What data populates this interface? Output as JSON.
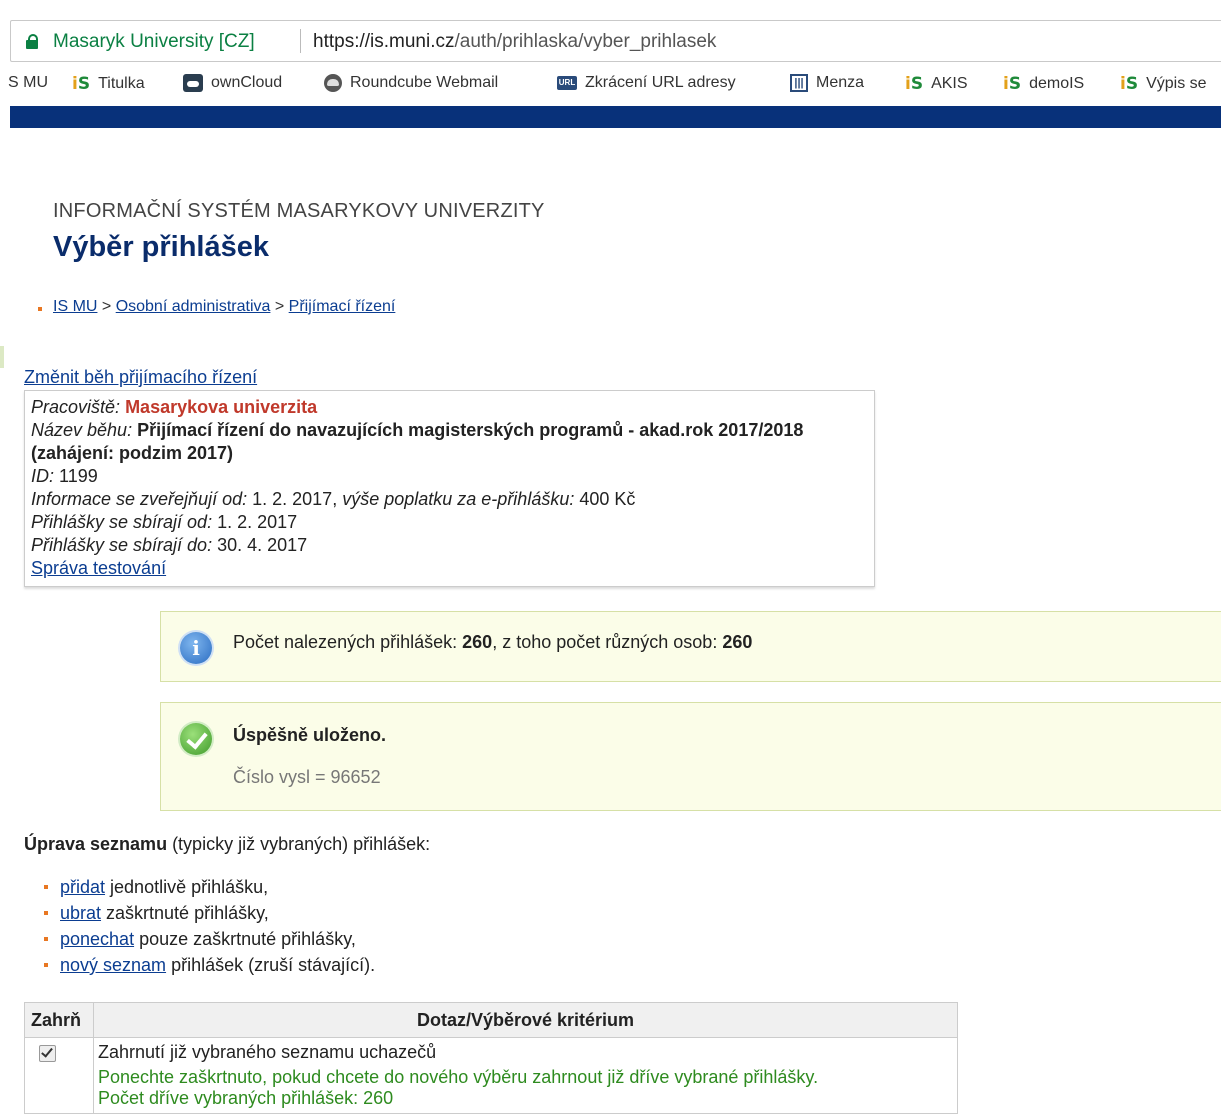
{
  "browser": {
    "origin": "Masaryk University [CZ]",
    "url_host": "https://is.muni.cz",
    "url_path": "/auth/prihlaska/vyber_prihlasek",
    "bookmarks": [
      "S MU",
      "Titulka",
      "ownCloud",
      "Roundcube Webmail",
      "Zkrácení URL adresy",
      "Menza",
      "AKIS",
      "demoIS",
      "Výpis se"
    ]
  },
  "page": {
    "system_name": "INFORMAČNÍ SYSTÉM MASARYKOVY UNIVERZITY",
    "title": "Výběr přihlášek",
    "breadcrumb": [
      "IS MU",
      "Osobní administrativa",
      "Přijímací řízení"
    ],
    "breadcrumb_sep": " > "
  },
  "change_link": "Změnit běh přijímacího řízení",
  "info": {
    "workplace_label": "Pracoviště:",
    "workplace": "Masarykova univerzita",
    "run_label": "Název běhu:",
    "run_name": "Přijímací řízení do navazujících magisterských programů - akad.rok 2017/2018 (zahájení: podzim 2017)",
    "id_label": "ID:",
    "id": "1199",
    "publish_label": "Informace se zveřejňují od:",
    "publish_from": "1. 2. 2017,",
    "fee_label": "výše poplatku za e-přihlášku:",
    "fee": "400 Kč",
    "collect_from_label": "Přihlášky se sbírají od:",
    "collect_from": "1. 2. 2017",
    "collect_to_label": "Přihlášky se sbírají do:",
    "collect_to": "30. 4. 2017",
    "testing_link": "Správa testování"
  },
  "notice_count": {
    "prefix": "Počet nalezených přihlášek: ",
    "count": "260",
    "middle": ", z toho počet různých osob: ",
    "persons": "260"
  },
  "notice_saved": {
    "heading": "Úspěšně uloženo.",
    "detail": "Číslo vysl = 96652"
  },
  "edit": {
    "heading_bold": "Úprava seznamu",
    "heading_rest": " (typicky již vybraných) přihlášek:",
    "ops": [
      {
        "link": "přidat",
        "text": " jednotlivě přihlášku,"
      },
      {
        "link": "ubrat",
        "text": " zaškrtnuté přihlášky,"
      },
      {
        "link": "ponechat",
        "text": " pouze zaškrtnuté přihlášky,"
      },
      {
        "link": "nový seznam",
        "text": " přihlášek (zruší stávající)."
      }
    ]
  },
  "criteria_table": {
    "col_include": "Zahrň",
    "col_query": "Dotaz/Výběrové kritérium",
    "row_title": "Zahrnutí již vybraného seznamu uchazečů",
    "row_hint": "Ponechte zaškrtnuto, pokud chcete do nového výběru zahrnout již dříve vybrané přihlášky.",
    "row_count": "Počet dříve vybraných přihlášek: 260"
  }
}
